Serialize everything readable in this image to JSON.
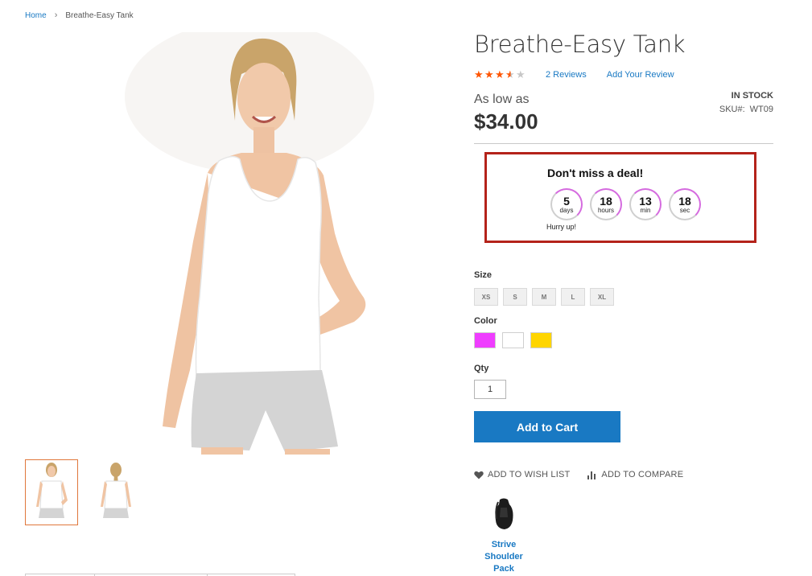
{
  "breadcrumb": {
    "home": "Home",
    "current": "Breathe-Easy Tank"
  },
  "product": {
    "title": "Breathe-Easy Tank",
    "rating": {
      "value": 3.5,
      "max": 5,
      "reviews_label": "2  Reviews",
      "add_review_label": "Add Your Review"
    },
    "as_low_as": "As low as",
    "price": "$34.00",
    "stock": "IN STOCK",
    "sku_label": "SKU#:",
    "sku_value": "WT09"
  },
  "deal": {
    "title": "Don't miss a deal!",
    "countdown": [
      {
        "value": "5",
        "unit": "days"
      },
      {
        "value": "18",
        "unit": "hours"
      },
      {
        "value": "13",
        "unit": "min"
      },
      {
        "value": "18",
        "unit": "sec"
      }
    ],
    "note": "Hurry up!",
    "border_color": "#b4231a",
    "ring_color": "#d56bdf"
  },
  "options": {
    "size_label": "Size",
    "sizes": [
      "XS",
      "S",
      "M",
      "L",
      "XL"
    ],
    "color_label": "Color",
    "colors": [
      "#ef3dff",
      "#ffffff",
      "#ffd500"
    ],
    "qty_label": "Qty",
    "qty_value": "1"
  },
  "buttons": {
    "add_to_cart": "Add to Cart",
    "wishlist": "ADD TO WISH LIST",
    "compare": "ADD TO COMPARE"
  },
  "related": {
    "name": "Strive Shoulder Pack"
  },
  "colors": {
    "link": "#1979c3",
    "primary_button": "#1979c3",
    "star": "#ff5501",
    "thumb_active": "#e0773b"
  }
}
